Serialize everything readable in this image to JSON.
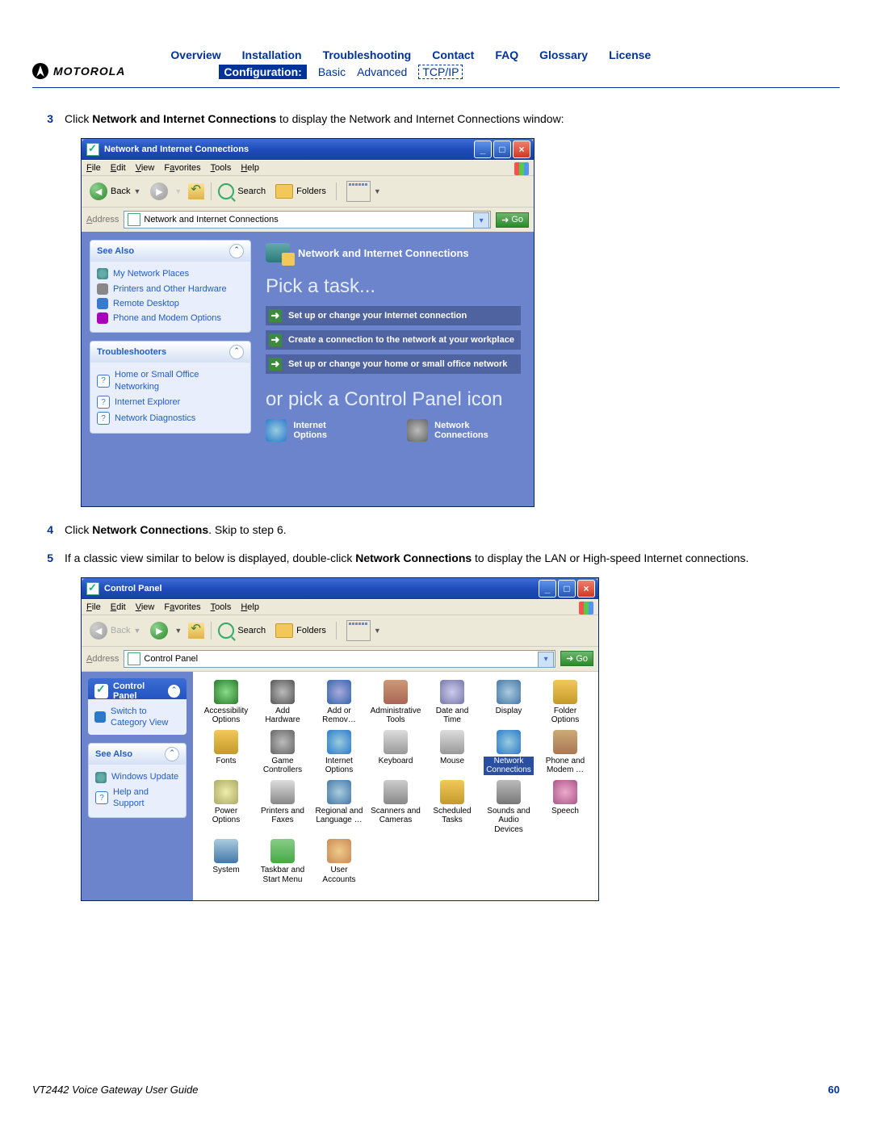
{
  "brand": "MOTOROLA",
  "nav": {
    "row1": [
      "Overview",
      "Installation",
      "Troubleshooting",
      "Contact",
      "FAQ",
      "Glossary",
      "License"
    ],
    "config_label": "Configuration:",
    "basic": "Basic",
    "advanced": "Advanced",
    "tcpip": "TCP/IP"
  },
  "steps": {
    "s3": {
      "num": "3",
      "pre": "Click ",
      "bold": "Network and Internet Connections",
      "post": " to display the Network and Internet Connections window:"
    },
    "s4": {
      "num": "4",
      "pre": "Click ",
      "bold": "Network Connections",
      "post": ". Skip to step 6."
    },
    "s5": {
      "num": "5",
      "pre": "If a classic view similar to below is displayed, double-click ",
      "bold": "Network Connections",
      "post": " to display the LAN or High-speed Internet connections."
    }
  },
  "win1": {
    "title": "Network and Internet Connections",
    "menu": [
      "File",
      "Edit",
      "View",
      "Favorites",
      "Tools",
      "Help"
    ],
    "toolbar": {
      "back": "Back",
      "search": "Search",
      "folders": "Folders"
    },
    "address_label": "Address",
    "address_value": "Network and Internet Connections",
    "go": "Go",
    "side": {
      "see_also": "See Also",
      "items1": [
        "My Network Places",
        "Printers and Other Hardware",
        "Remote Desktop",
        "Phone and Modem Options"
      ],
      "troubleshooters": "Troubleshooters",
      "items2": [
        "Home or Small Office Networking",
        "Internet Explorer",
        "Network Diagnostics"
      ]
    },
    "main": {
      "header": "Network and Internet Connections",
      "pick": "Pick a task...",
      "tasks": [
        "Set up or change your Internet connection",
        "Create a connection to the network at your workplace",
        "Set up or change your home or small office network"
      ],
      "or_pick": "or pick a Control Panel icon",
      "cp": [
        "Internet Options",
        "Network Connections"
      ]
    }
  },
  "win2": {
    "title": "Control Panel",
    "menu": [
      "File",
      "Edit",
      "View",
      "Favorites",
      "Tools",
      "Help"
    ],
    "toolbar": {
      "back": "Back",
      "search": "Search",
      "folders": "Folders"
    },
    "address_label": "Address",
    "address_value": "Control Panel",
    "go": "Go",
    "side": {
      "cp": "Control Panel",
      "switch": "Switch to Category View",
      "see_also": "See Also",
      "items": [
        "Windows Update",
        "Help and Support"
      ]
    },
    "grid": [
      {
        "label": "Accessibility Options",
        "cls": "gAccess"
      },
      {
        "label": "Add Hardware",
        "cls": "gHw"
      },
      {
        "label": "Add or Remov…",
        "cls": "gAddRemove"
      },
      {
        "label": "Administrative Tools",
        "cls": "gAdmin"
      },
      {
        "label": "Date and Time",
        "cls": "gDate"
      },
      {
        "label": "Display",
        "cls": "gDisplay"
      },
      {
        "label": "Folder Options",
        "cls": "gFolder"
      },
      {
        "label": "Fonts",
        "cls": "gFonts"
      },
      {
        "label": "Game Controllers",
        "cls": "gGame"
      },
      {
        "label": "Internet Options",
        "cls": "gInet"
      },
      {
        "label": "Keyboard",
        "cls": "gKeyb"
      },
      {
        "label": "Mouse",
        "cls": "gMouse"
      },
      {
        "label": "Network Connections",
        "cls": "gNet",
        "sel": true
      },
      {
        "label": "Phone and Modem …",
        "cls": "gPhone"
      },
      {
        "label": "Power Options",
        "cls": "gPower"
      },
      {
        "label": "Printers and Faxes",
        "cls": "gPrint"
      },
      {
        "label": "Regional and Language …",
        "cls": "gRegion"
      },
      {
        "label": "Scanners and Cameras",
        "cls": "gScan"
      },
      {
        "label": "Scheduled Tasks",
        "cls": "gSched"
      },
      {
        "label": "Sounds and Audio Devices",
        "cls": "gSound"
      },
      {
        "label": "Speech",
        "cls": "gSpeech"
      },
      {
        "label": "System",
        "cls": "gSys"
      },
      {
        "label": "Taskbar and Start Menu",
        "cls": "gTask"
      },
      {
        "label": "User Accounts",
        "cls": "gUsers"
      }
    ]
  },
  "footer": {
    "guide": "VT2442 Voice Gateway User Guide",
    "page": "60"
  }
}
